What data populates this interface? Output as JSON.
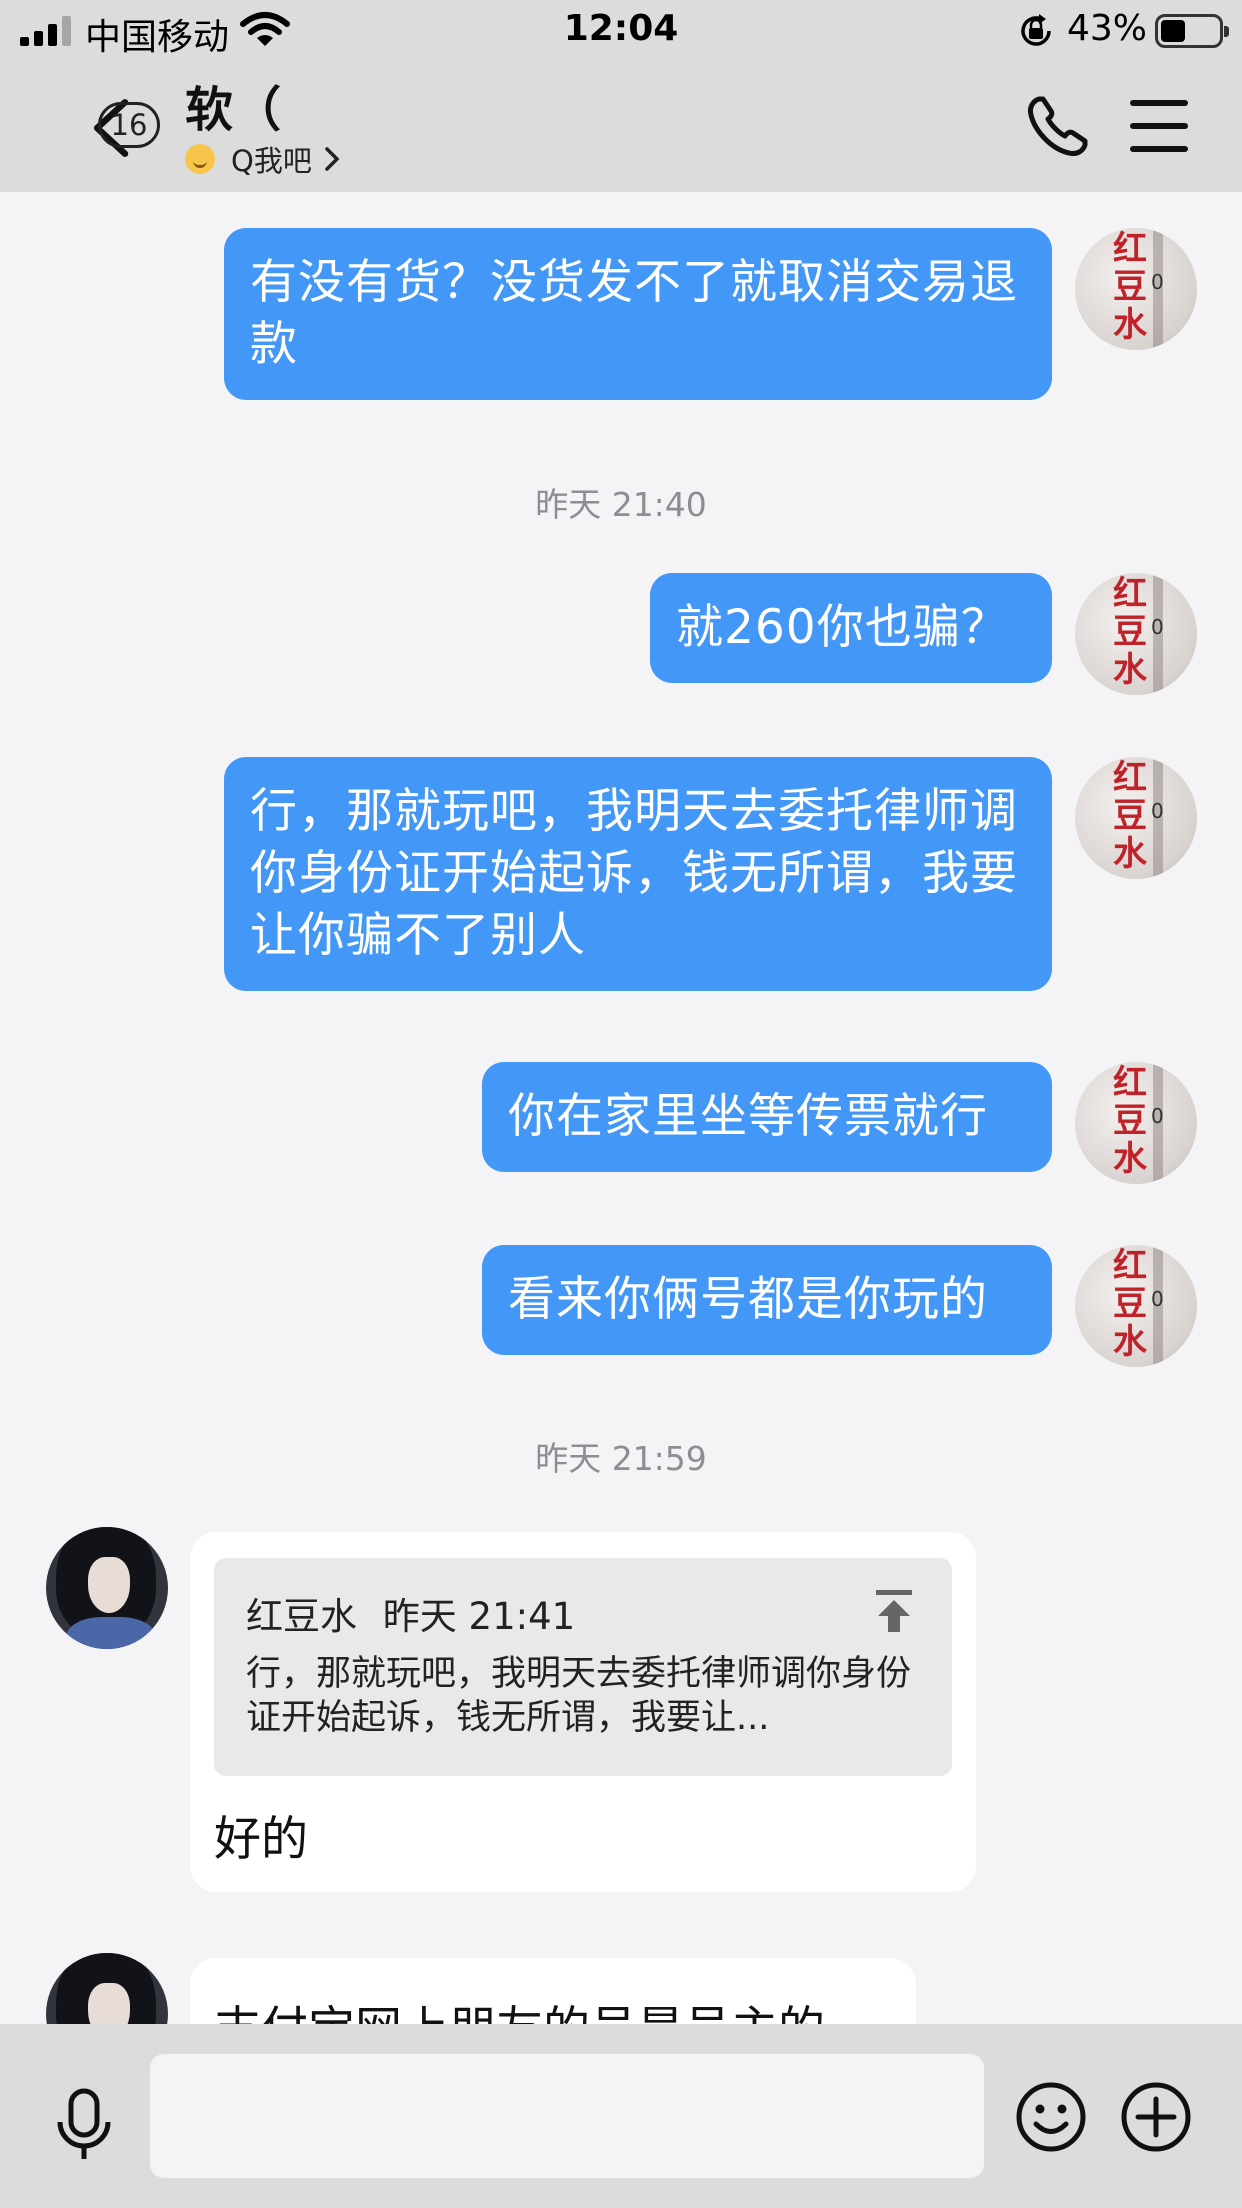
{
  "status_bar": {
    "carrier": "中国移动",
    "time": "12:04",
    "battery_percent": "43%",
    "battery_level": 0.43,
    "signal_bars": 3,
    "signal_bars_total": 4,
    "icons": [
      "signal-icon",
      "wifi-icon",
      "rotation-lock-icon",
      "battery-icon"
    ]
  },
  "nav": {
    "unread_count": "16",
    "contact_name": "软（",
    "status_text": "Q我吧",
    "icons": [
      "back-chevron-icon",
      "smile-status-icon",
      "phone-icon",
      "menu-icon"
    ]
  },
  "messages": [
    {
      "side": "out",
      "text": "有没有货？没货发不了就取消交易退款"
    },
    {
      "timestamp": "昨天 21:40"
    },
    {
      "side": "out",
      "text": "就260你也骗？"
    },
    {
      "side": "out",
      "text": "行，那就玩吧，我明天去委托律师调你身份证开始起诉，钱无所谓，我要让你骗不了别人"
    },
    {
      "side": "out",
      "text": "你在家里坐等传票就行"
    },
    {
      "side": "out",
      "text": "看来你俩号都是你玩的"
    },
    {
      "timestamp": "昨天 21:59"
    },
    {
      "side": "in",
      "quote": {
        "author": "红豆水",
        "time": "昨天 21:41",
        "text": "行，那就玩吧，我明天去委托律师调你身份证开始起诉，钱无所谓，我要让..."
      },
      "text": "好的"
    },
    {
      "side": "in",
      "text": "支付宝网上朋友的号是号主的"
    }
  ],
  "self_avatar": {
    "label": "红豆水",
    "mark": "0"
  },
  "input_bar": {
    "placeholder": "",
    "icons": [
      "microphone-icon",
      "emoji-icon",
      "plus-icon"
    ]
  },
  "colors": {
    "outgoing_bubble": "#4297f7",
    "incoming_bubble": "#ffffff",
    "bars": "#dcdcdc",
    "chat_background": "#f4f4f6",
    "timestamp_text": "#8d8d92"
  }
}
